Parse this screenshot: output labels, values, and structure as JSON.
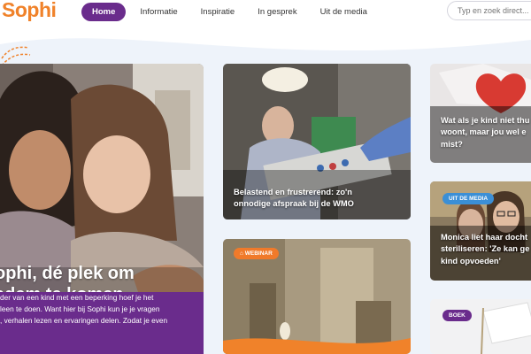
{
  "header": {
    "logo": "Sophi",
    "nav": [
      {
        "label": "Home",
        "active": true
      },
      {
        "label": "Informatie",
        "active": false
      },
      {
        "label": "Inspiratie",
        "active": false
      },
      {
        "label": "In gesprek",
        "active": false
      },
      {
        "label": "Uit de media",
        "active": false
      }
    ],
    "search_placeholder": "Typ en zoek direct..."
  },
  "hero": {
    "title_line1": "ophi, dé plek om",
    "title_line2": "adem te komen",
    "text_lines": [
      "der van een kind met een beperking hoef je het",
      "leen te doen. Want hier bij Sophi kun je je vragen",
      ", verhalen lezen en ervaringen delen. Zodat je even"
    ]
  },
  "articles": [
    {
      "title_line1": "Belastend en frustrerend: zo'n",
      "title_line2": "onnodige afspraak bij de WMO"
    },
    {
      "title_line1": "Wat als je kind niet thu",
      "title_line2": "woont, maar jou wel e",
      "title_line3": "mist?"
    },
    {
      "badge": "UIT DE MEDIA",
      "title_line1": "Monica liet haar docht",
      "title_line2": "steriliseren: 'Ze kan ge",
      "title_line3": "kind opvoeden'"
    },
    {
      "badge": "WEBINAR"
    },
    {
      "badge": "BOEK"
    }
  ],
  "colors": {
    "brand_purple": "#6a2c8c",
    "brand_orange": "#f0822a",
    "media_blue": "#3b8fd6"
  }
}
